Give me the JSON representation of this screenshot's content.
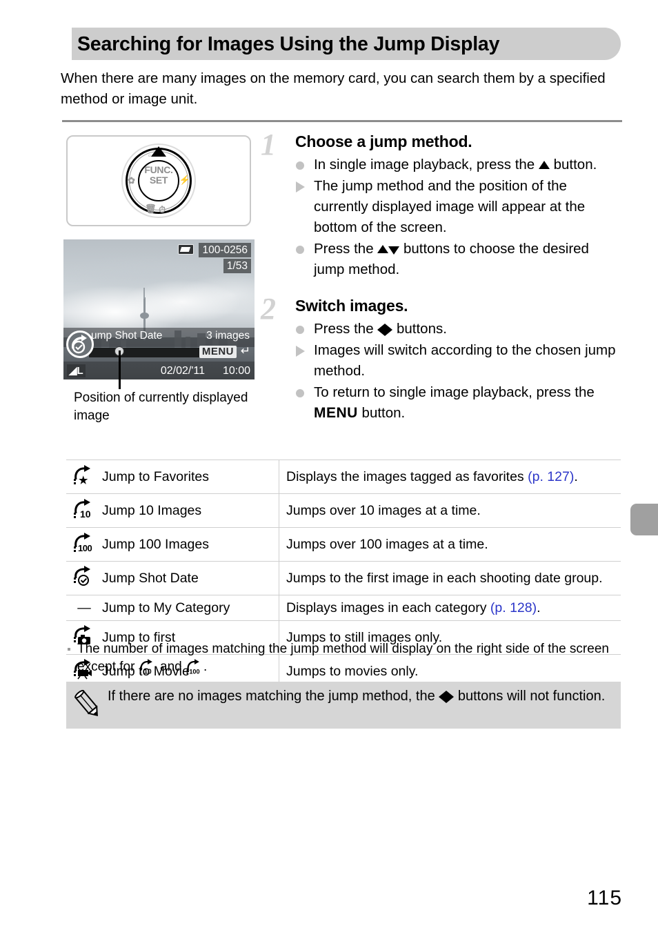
{
  "header": {
    "title": "Searching for Images Using the Jump Display"
  },
  "intro": "When there are many images on the memory card, you can search them by a specified method or image unit.",
  "dial": {
    "center_line1": "FUNC.",
    "center_line2": "SET",
    "macro_icon": "macro-flower-icon",
    "flash_icon": "flash-bolt-icon",
    "delete_icon": "trash-icon",
    "timer_icon": "self-timer-icon",
    "display_icon": "display-icon",
    "up_arrow_icon": "up-arrow-icon"
  },
  "lcd": {
    "folder_number": "100-0256",
    "image_index": "1/53",
    "battery_icon": "battery-full-icon",
    "jump_method_label": "ump Shot Date",
    "jump_count": "3 images",
    "menu_chip": "MENU",
    "return_arrow": "↵",
    "date": "02/02/'11",
    "time": "10:00",
    "quality": "L",
    "jump_icon": "jump-shot-date-icon",
    "scrollbar_icon": "position-scrollbar"
  },
  "lcd_caption": "Position of currently displayed image",
  "steps": [
    {
      "number": "1",
      "title": "Choose a jump method.",
      "items": [
        {
          "bullet": "dot",
          "parts": [
            {
              "t": "text",
              "v": "In single image playback, press the "
            },
            {
              "t": "glyph",
              "v": "up"
            },
            {
              "t": "text",
              "v": " button."
            }
          ]
        },
        {
          "bullet": "tri",
          "parts": [
            {
              "t": "text",
              "v": "The jump method and the position of the currently displayed image will appear at the bottom of the screen."
            }
          ]
        },
        {
          "bullet": "dot",
          "parts": [
            {
              "t": "text",
              "v": "Press the "
            },
            {
              "t": "glyph",
              "v": "up"
            },
            {
              "t": "glyph",
              "v": "down"
            },
            {
              "t": "text",
              "v": " buttons to choose the desired jump method."
            }
          ]
        }
      ]
    },
    {
      "number": "2",
      "title": "Switch images.",
      "items": [
        {
          "bullet": "dot",
          "parts": [
            {
              "t": "text",
              "v": "Press the "
            },
            {
              "t": "glyph",
              "v": "left"
            },
            {
              "t": "glyph",
              "v": "right"
            },
            {
              "t": "text",
              "v": " buttons."
            }
          ]
        },
        {
          "bullet": "tri",
          "parts": [
            {
              "t": "text",
              "v": "Images will switch according to the chosen jump method."
            }
          ]
        },
        {
          "bullet": "dot",
          "parts": [
            {
              "t": "text",
              "v": "To return to single image playback, press the "
            },
            {
              "t": "menu",
              "v": "MENU"
            },
            {
              "t": "text",
              "v": " button."
            }
          ]
        }
      ]
    }
  ],
  "table": {
    "rows": [
      {
        "icon": "jump-to-favorites-icon",
        "sym": "star",
        "name": "Jump to Favorites",
        "desc": "Displays the images tagged as favorites ",
        "ref": "(p. 127)",
        "desc_end": "."
      },
      {
        "icon": "jump-10-images-icon",
        "sym": "10",
        "name": "Jump 10 Images",
        "desc": "Jumps over 10 images at a time.",
        "ref": "",
        "desc_end": ""
      },
      {
        "icon": "jump-100-images-icon",
        "sym": "100",
        "name": "Jump 100 Images",
        "desc": "Jumps over 100 images at a time.",
        "ref": "",
        "desc_end": ""
      },
      {
        "icon": "jump-shot-date-icon",
        "sym": "clock",
        "name": "Jump Shot Date",
        "desc": "Jumps to the first image in each shooting date group.",
        "ref": "",
        "desc_end": ""
      },
      {
        "icon": "no-icon-dash",
        "sym": "dash",
        "name": "Jump to My Category",
        "desc": "Displays images in each category ",
        "ref": "(p. 128)",
        "desc_end": "."
      },
      {
        "icon": "jump-to-first-icon",
        "sym": "camera",
        "name": "Jump to first",
        "desc": "Jumps to still images only.",
        "ref": "",
        "desc_end": ""
      },
      {
        "icon": "jump-to-movie-icon",
        "sym": "movie",
        "name": "Jump to Movie",
        "desc": "Jumps to movies only.",
        "ref": "",
        "desc_end": ""
      }
    ]
  },
  "footnote": {
    "part1": "The number of images matching the jump method will display on the right side of the screen except for ",
    "part2": " and ",
    "part3": "."
  },
  "note": {
    "part1": "If there are no images matching the jump method, the ",
    "part2": " buttons will not function.",
    "icon": "pencil-note-icon"
  },
  "page_number": "115",
  "edge_tab": "chapter-index-tab",
  "colors": {
    "header_band": "#cdcdcd",
    "rule": "#8c8c8c",
    "step_number": "#d2d2d2",
    "bullet": "#c2c2c2",
    "page_ref_link": "#2b35c8",
    "note_box": "#d6d6d6",
    "edge_tab": "#a0a0a0",
    "table_border": "#cfcfcf"
  }
}
